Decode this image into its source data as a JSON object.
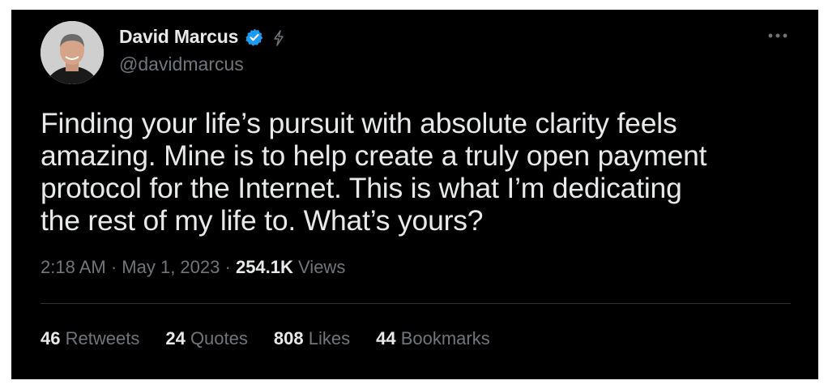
{
  "author": {
    "display_name": "David Marcus",
    "handle": "@davidmarcus",
    "verified": true
  },
  "tweet": {
    "text": "Finding your life’s pursuit with absolute clarity feels\namazing. Mine is to help create a truly open payment\nprotocol for the Internet. This is what I’m dedicating\nthe rest of my life to. What’s yours?",
    "time": "2:18 AM",
    "date": "May 1, 2023",
    "separator": "·",
    "views_count": "254.1K",
    "views_label": "Views"
  },
  "stats": [
    {
      "count": "46",
      "label": "Retweets"
    },
    {
      "count": "24",
      "label": "Quotes"
    },
    {
      "count": "808",
      "label": "Likes"
    },
    {
      "count": "44",
      "label": "Bookmarks"
    }
  ],
  "colors": {
    "background": "#000000",
    "text_primary": "#e7e9ea",
    "text_secondary": "#71767b",
    "verified_blue": "#1d9bf0",
    "divider": "#2f3336"
  },
  "icons": {
    "verified": "verified-badge-icon",
    "automated": "lightning-icon",
    "more": "more-dots-icon"
  }
}
